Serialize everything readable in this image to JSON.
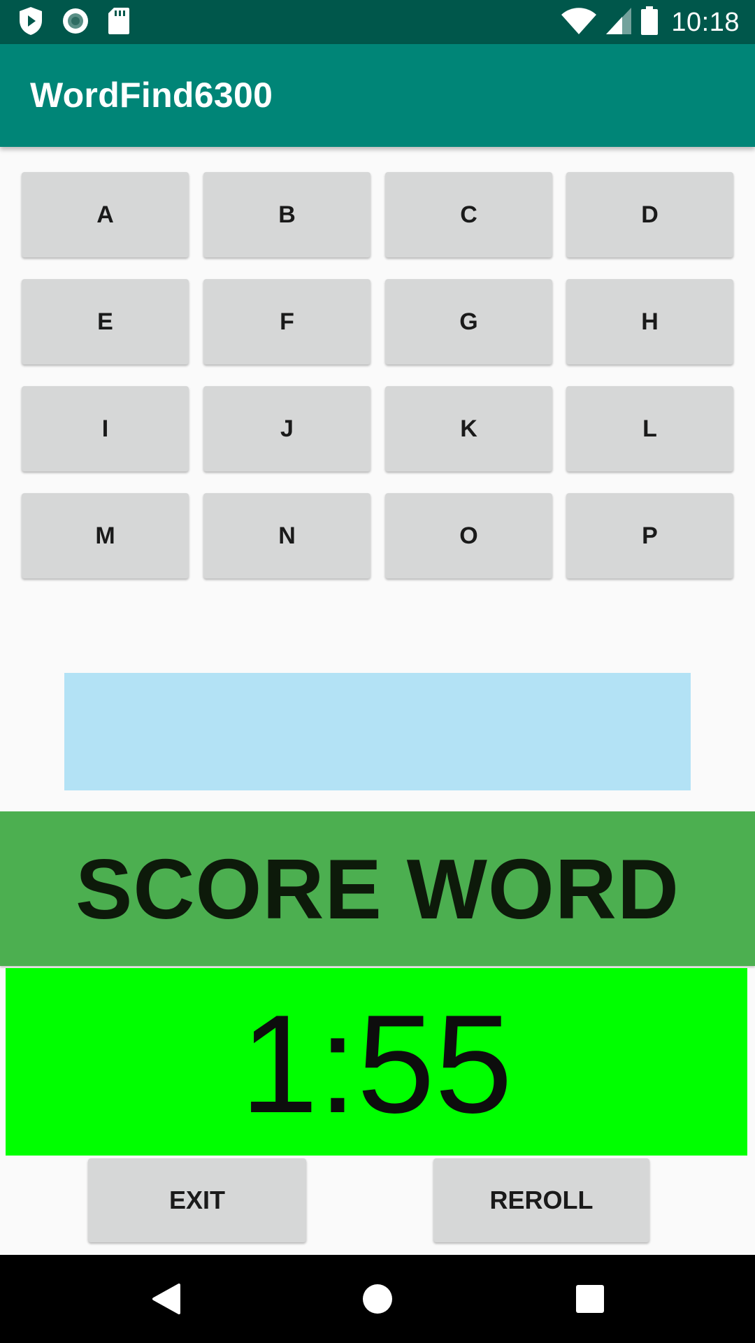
{
  "status_bar": {
    "time": "10:18",
    "left_icons": [
      "play-protect-icon",
      "sync-icon",
      "sd-card-icon"
    ],
    "right_icons": [
      "wifi-icon",
      "cell-signal-icon",
      "battery-icon"
    ]
  },
  "app_bar": {
    "title": "WordFind6300"
  },
  "letters": [
    "A",
    "B",
    "C",
    "D",
    "E",
    "F",
    "G",
    "H",
    "I",
    "J",
    "K",
    "L",
    "M",
    "N",
    "O",
    "P"
  ],
  "word_display": {
    "text": ""
  },
  "score_button": {
    "label": "SCORE WORD"
  },
  "timer": {
    "value": "1:55"
  },
  "bottom_buttons": {
    "exit_label": "EXIT",
    "reroll_label": "REROLL"
  },
  "nav_bar": {
    "items": [
      "back-icon",
      "home-icon",
      "recents-icon"
    ]
  },
  "colors": {
    "status_bar": "#00574b",
    "app_bar": "#008577",
    "word_display": "#b3e2f5",
    "score_button": "#4caf50",
    "timer": "#00ff00",
    "button": "#d6d7d7"
  }
}
